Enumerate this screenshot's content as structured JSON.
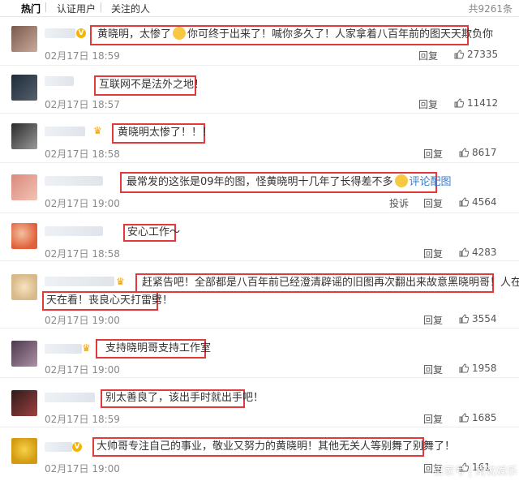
{
  "tabs": [
    {
      "label": "热门",
      "active": true
    },
    {
      "label": "认证用户",
      "active": false
    },
    {
      "label": "关注的人",
      "active": false
    }
  ],
  "total_count": "共9261条",
  "reply_label": "回复",
  "report_label": "投诉",
  "comments": [
    {
      "text": "黄晓明，太惨了",
      "text2": "你可终于出来了！喊你多久了！人家拿着八百年前的图天天欺负你",
      "time": "02月17日 18:59",
      "likes": "27335"
    },
    {
      "text": "互联网不是法外之地！",
      "time": "02月17日 18:57",
      "likes": "11412"
    },
    {
      "text": "黄晓明太惨了！！！",
      "time": "02月17日 18:58",
      "likes": "8617"
    },
    {
      "text": "最常发的这张是09年的图，怪黄晓明十几年了长得差不多",
      "link": "评论配图",
      "time": "02月17日 19:00",
      "likes": "4564"
    },
    {
      "text": "安心工作～",
      "time": "02月17日 18:58",
      "likes": "4283"
    },
    {
      "text": "赶紧告吧！全部都是八百年前已经澄清辟谣的旧图再次翻出来故意黑晓明哥！人在做",
      "text2": "天在看！丧良心天打雷劈！",
      "time": "02月17日 19:00",
      "likes": "3554"
    },
    {
      "text": "支持晓明哥支持工作室",
      "time": "02月17日 19:00",
      "likes": "1958"
    },
    {
      "text": "别太善良了，该出手时就出手吧！",
      "time": "02月17日 18:59",
      "likes": "1685"
    },
    {
      "text": "大帅哥专注自己的事业，敬业又努力的黄晓明！其他无关人等别舞了别舞了！",
      "time": "02月17日 19:00",
      "likes": "161"
    }
  ],
  "watermark": "百家号 | 南说娱乐",
  "colors": {
    "highlight": "#e23a3a",
    "link": "#3b7bc9",
    "badge": "#f5b400"
  }
}
